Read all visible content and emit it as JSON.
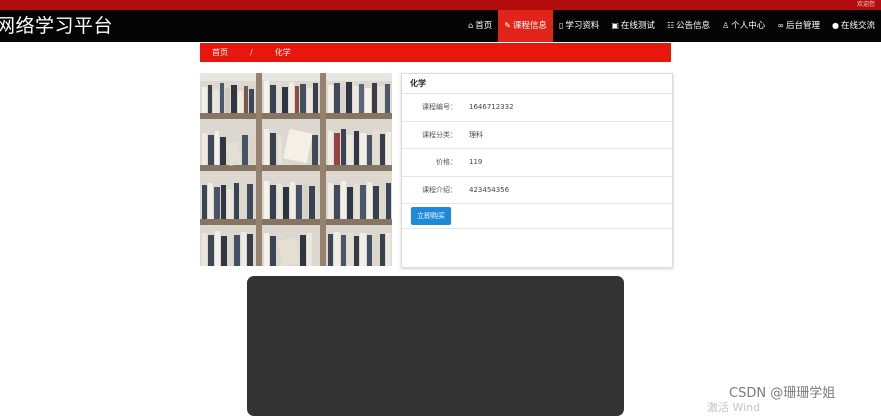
{
  "topbar": {
    "welcome": "欢迎您"
  },
  "header": {
    "brand": "网络学习平台"
  },
  "nav": {
    "items": [
      {
        "icon": "home-icon",
        "label": "首页"
      },
      {
        "icon": "course-icon",
        "label": "课程信息",
        "active": true
      },
      {
        "icon": "book-icon",
        "label": "学习资料"
      },
      {
        "icon": "test-icon",
        "label": "在线测试"
      },
      {
        "icon": "notice-icon",
        "label": "公告信息"
      },
      {
        "icon": "user-icon",
        "label": "个人中心"
      },
      {
        "icon": "link-icon",
        "label": "后台管理"
      },
      {
        "icon": "chat-icon",
        "label": "在线交流"
      }
    ]
  },
  "breadcrumb": {
    "home": "首页",
    "separator": "/",
    "current": "化学"
  },
  "detail": {
    "title": "化学",
    "fields": [
      {
        "label": "课程编号：",
        "value": "1646712332"
      },
      {
        "label": "课程分类：",
        "value": "理科"
      },
      {
        "label": "价格：",
        "value": "119"
      },
      {
        "label": "课程介绍：",
        "value": "423454356"
      }
    ],
    "buy_button": "立即购买"
  },
  "watermark": {
    "text": "CSDN @珊珊学姐",
    "partial": "激活 Wind"
  },
  "colors": {
    "accent": "#e2231a",
    "navbar": "#050505",
    "button": "#1c8ad8"
  }
}
